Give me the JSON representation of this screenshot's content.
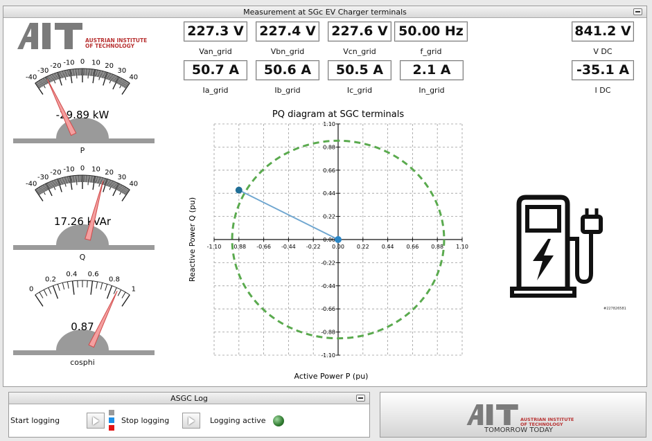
{
  "main_panel": {
    "title": "Measurement at SGc EV Charger terminals"
  },
  "logo_text": {
    "line1": "AUSTRIAN INSTITUTE",
    "line2": "OF TECHNOLOGY"
  },
  "measurements": [
    {
      "id": "van",
      "value": "227.3 V",
      "label": "Van_grid"
    },
    {
      "id": "vbn",
      "value": "227.4 V",
      "label": "Vbn_grid"
    },
    {
      "id": "vcn",
      "value": "227.6 V",
      "label": "Vcn_grid"
    },
    {
      "id": "f",
      "value": "50.00 Hz",
      "label": "f_grid"
    },
    {
      "id": "ia",
      "value": "50.7 A",
      "label": "Ia_grid"
    },
    {
      "id": "ib",
      "value": "50.6 A",
      "label": "Ib_grid"
    },
    {
      "id": "ic",
      "value": "50.5 A",
      "label": "Ic_grid"
    },
    {
      "id": "in",
      "value": "2.1 A",
      "label": "In_grid"
    },
    {
      "id": "vdc",
      "value": "841.2 V",
      "label": "V DC"
    },
    {
      "id": "idc",
      "value": "-35.1 A",
      "label": "I DC"
    }
  ],
  "gauges": [
    {
      "id": "p",
      "label": "P",
      "readout": "-29.89 kW",
      "min": -40,
      "max": 40,
      "value": -29.89,
      "ticks": [
        "-40",
        "-30",
        "-20",
        "-10",
        "0",
        "10",
        "20",
        "30",
        "40"
      ]
    },
    {
      "id": "q",
      "label": "Q",
      "readout": "17.26 kVAr",
      "min": -40,
      "max": 40,
      "value": 17.26,
      "ticks": [
        "-40",
        "-30",
        "-20",
        "-10",
        "0",
        "10",
        "20",
        "30",
        "40"
      ]
    },
    {
      "id": "cosphi",
      "label": "cosphi",
      "readout": "0.87",
      "min": 0,
      "max": 1,
      "value": 0.87,
      "ticks": [
        "0",
        "0.2",
        "0.4",
        "0.6",
        "0.8",
        "1"
      ]
    }
  ],
  "chart_data": {
    "type": "scatter",
    "title": "PQ diagram at SGC terminals",
    "xlabel": "Active Power P (pu)",
    "ylabel": "Reactive Power Q (pu)",
    "xlim": [
      -1.1,
      1.1
    ],
    "ylim": [
      -1.1,
      1.1
    ],
    "ticks": [
      "-1.10",
      "-0.88",
      "-0.66",
      "-0.44",
      "-0.22",
      "0.00",
      "0.22",
      "0.44",
      "0.66",
      "0.88",
      "1.10"
    ],
    "grid": true,
    "circle_radius": 0.94,
    "circle_color": "#5aaa4e",
    "line_color": "#6fa6d0",
    "point_color": "#1f6e96",
    "origin": [
      0,
      0
    ],
    "point": [
      -0.88,
      0.47
    ]
  },
  "charger_icon": {
    "name": "ev-charger-icon",
    "caption": "#227826581"
  },
  "log_panel": {
    "title": "ASGC Log",
    "start_label": "Start logging",
    "stop_label": "Stop logging",
    "active_label": "Logging active"
  },
  "footer_logo": {
    "line1": "AUSTRIAN INSTITUTE",
    "line2": "OF TECHNOLOGY",
    "tagline": "TOMORROW TODAY"
  }
}
